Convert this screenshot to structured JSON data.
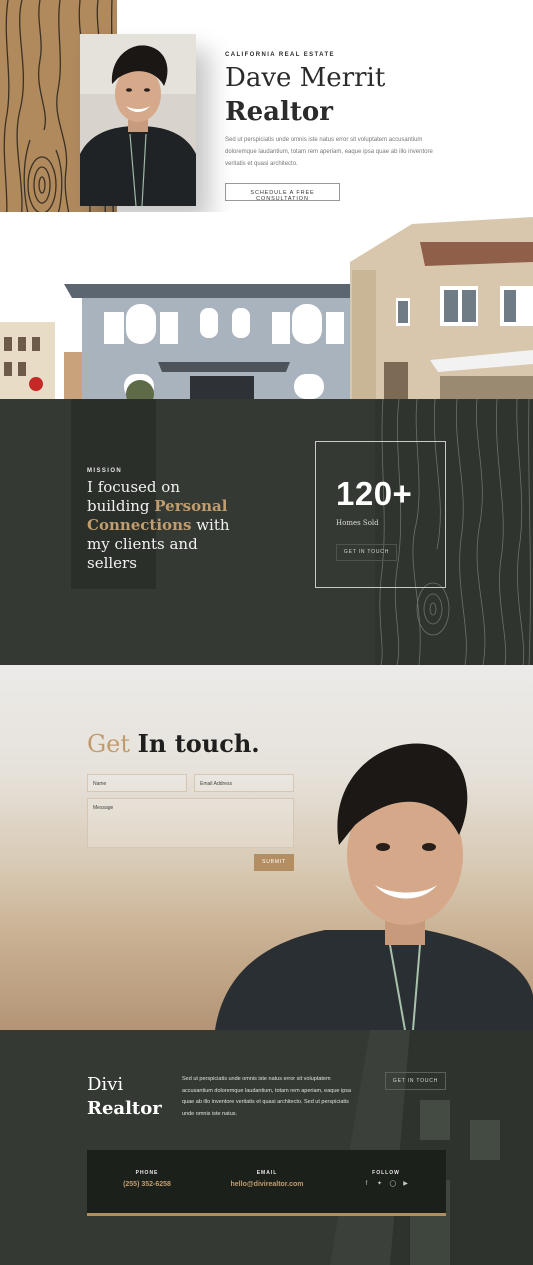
{
  "hero": {
    "eyebrow": "CALIFORNIA REAL ESTATE",
    "name_line1": "Dave Merrit",
    "name_line2": "Realtor",
    "body": "Sed ut perspiciatis unde omnis iste natus error sit voluptatem accusantium doloremque laudantium, totam rem aperiam, eaque ipsa quae ab illo inventore veritatis et quasi architecto.",
    "cta_label": "SCHEDULE A FREE CONSULTATION"
  },
  "mission": {
    "eyebrow": "MISSION",
    "text_before": "I focused on building ",
    "text_accent": "Personal Connections",
    "text_after": " with my clients and sellers",
    "stat_number": "120+",
    "stat_label": "Homes Sold",
    "stat_button": "GET IN TOUCH"
  },
  "contact": {
    "title_light": "Get",
    "title_dark": "In touch.",
    "name_placeholder": "Name",
    "email_placeholder": "Email Address",
    "message_placeholder": "Message",
    "submit_label": "SUBMIT"
  },
  "footer": {
    "brand_line1": "Divi",
    "brand_line2": "Realtor",
    "body": "Sed ut perspiciatis unde omnis iste natus error sit voluptatem accusantium doloremque laudantium, totam rem aperiam, eaque ipsa quae ab illo inventore veritatis et quasi architecto. Sed ut perspiciatis unde omnis iste natus.",
    "button_label": "GET IN TOUCH",
    "phone_label": "PHONE",
    "phone_value": "(255) 352-6258",
    "email_label": "EMAIL",
    "email_value": "hello@divirealtor.com",
    "follow_label": "FOLLOW",
    "social_icons": [
      "facebook-icon",
      "twitter-icon",
      "instagram-icon",
      "youtube-icon"
    ]
  },
  "colors": {
    "accent": "#c19c6e",
    "dark_green": "#343a33",
    "wood": "#b08a5d"
  }
}
